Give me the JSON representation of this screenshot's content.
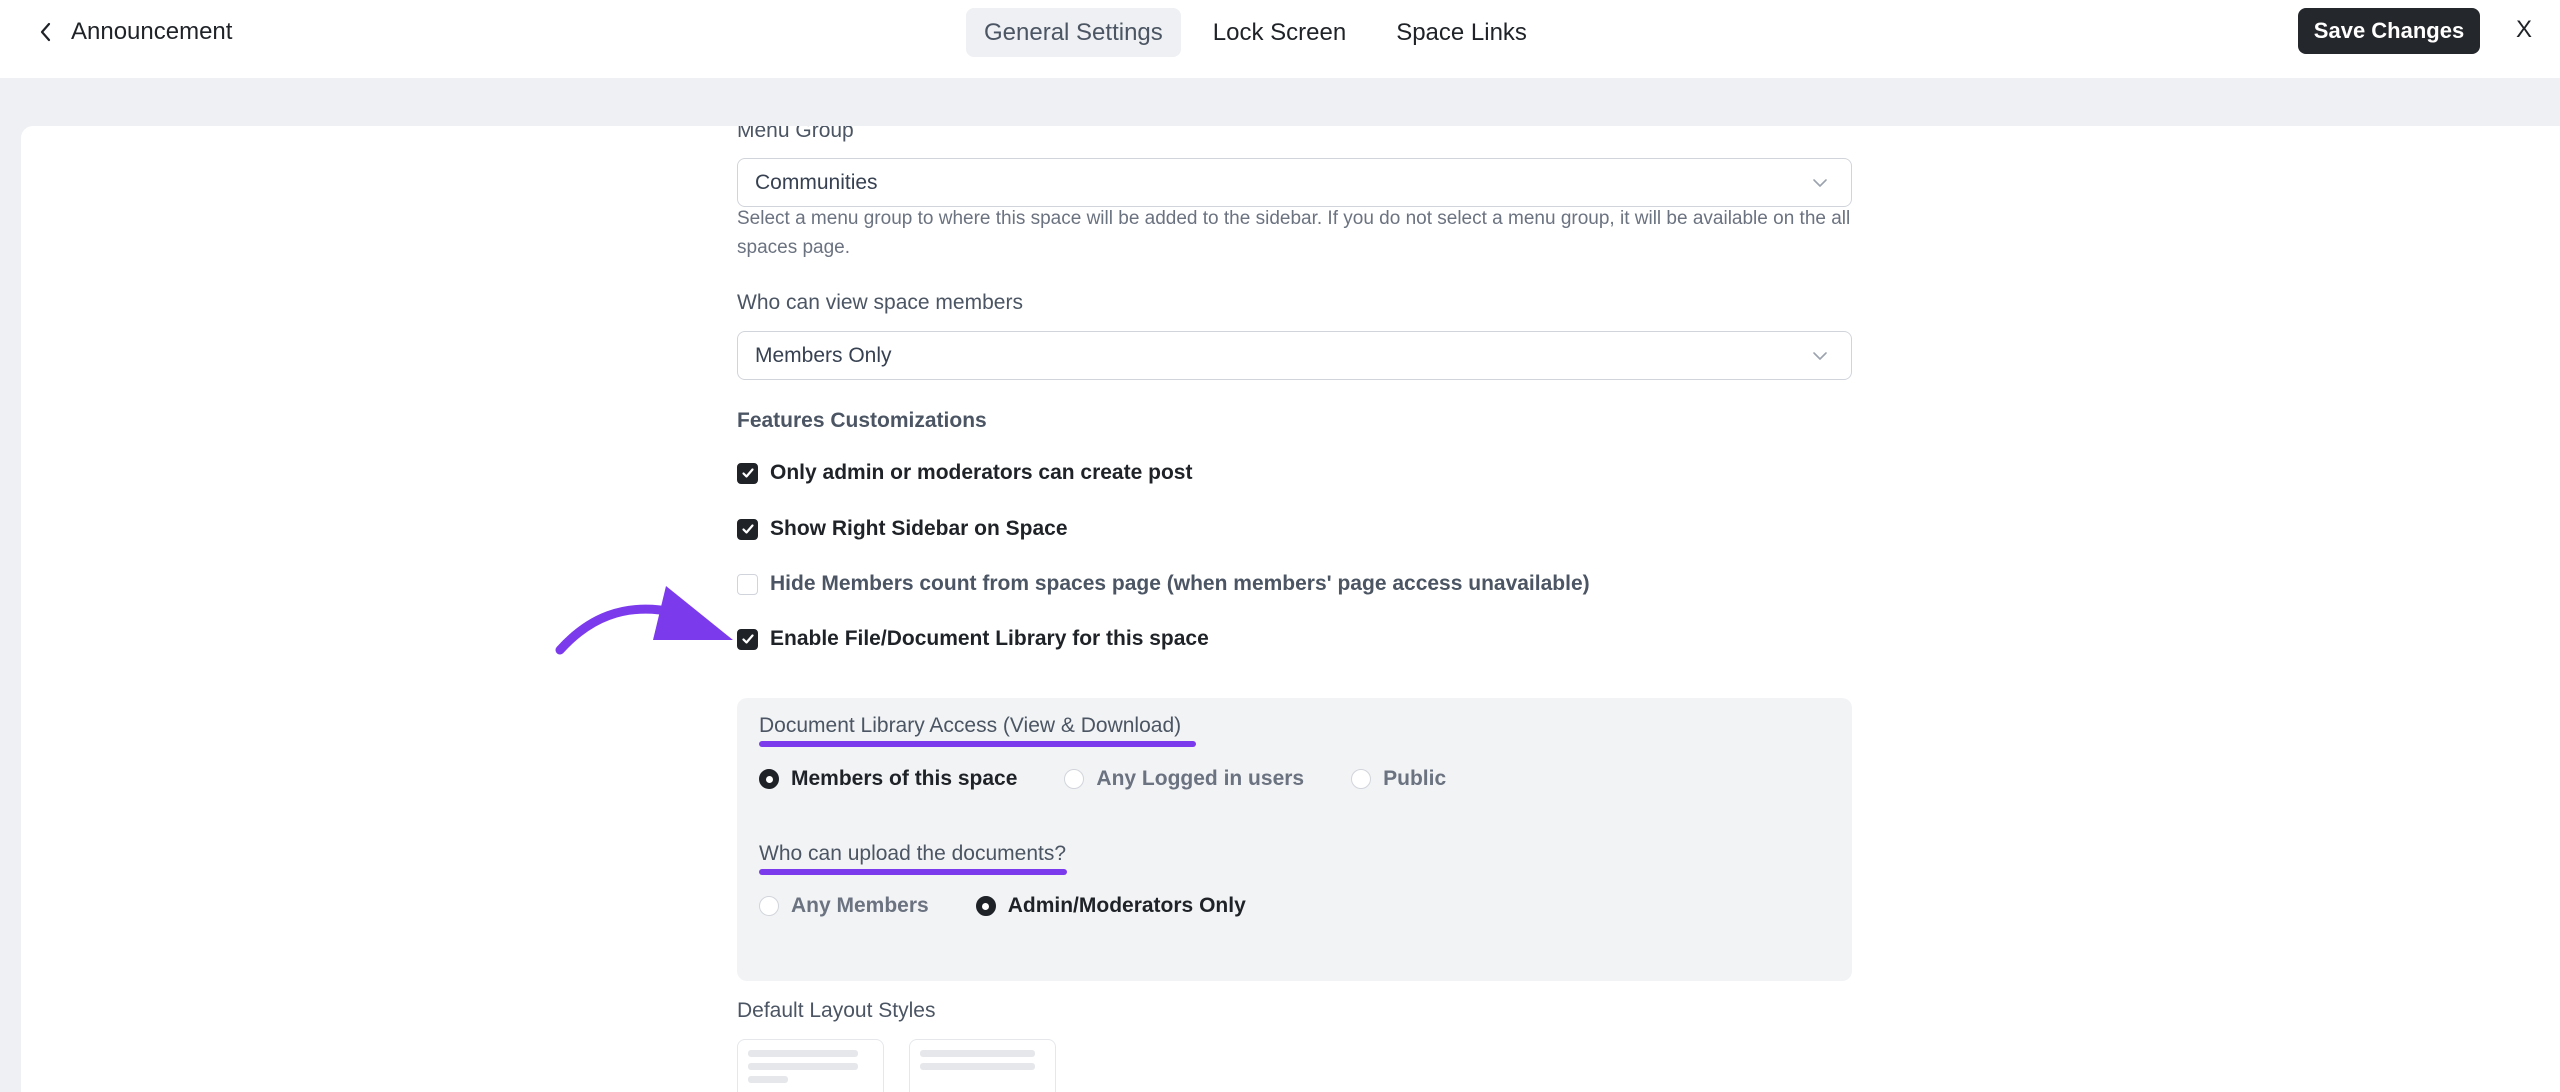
{
  "header": {
    "title": "Announcement",
    "tabs": [
      {
        "label": "General Settings",
        "active": true
      },
      {
        "label": "Lock Screen",
        "active": false
      },
      {
        "label": "Space Links",
        "active": false
      }
    ],
    "save_label": "Save Changes",
    "close_label": "X"
  },
  "form": {
    "menu_group": {
      "label": "Menu Group",
      "value": "Communities",
      "help": "Select a menu group to where this space will be added to the sidebar. If you do not select a menu group, it will be available on the all spaces page."
    },
    "members_visibility": {
      "label": "Who can view space members",
      "value": "Members Only"
    },
    "features": {
      "heading": "Features Customizations",
      "options": [
        {
          "label": "Only admin or moderators can create post",
          "checked": true
        },
        {
          "label": "Show Right Sidebar on Space",
          "checked": true
        },
        {
          "label": "Hide Members count from spaces page (when members' page access unavailable)",
          "checked": false
        },
        {
          "label": "Enable File/Document Library for this space",
          "checked": true
        }
      ]
    },
    "document_library": {
      "access_label": "Document Library Access (View & Download)",
      "access_options": [
        {
          "label": "Members of this space",
          "selected": true
        },
        {
          "label": "Any Logged in users",
          "selected": false
        },
        {
          "label": "Public",
          "selected": false
        }
      ],
      "upload_label": "Who can upload the documents?",
      "upload_options": [
        {
          "label": "Any Members",
          "selected": false
        },
        {
          "label": "Admin/Moderators Only",
          "selected": true
        }
      ]
    },
    "layout": {
      "label": "Default Layout Styles"
    }
  },
  "colors": {
    "accent": "#7c3aed",
    "primary_button": "#24272b",
    "page_bg": "#eef0f3"
  }
}
